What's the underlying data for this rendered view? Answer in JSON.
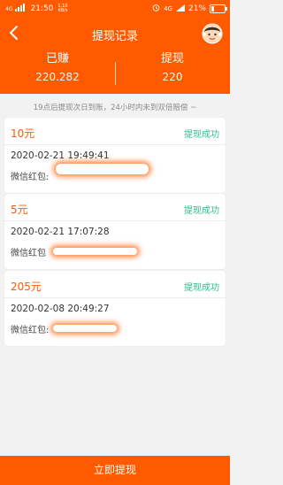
{
  "status_bar": {
    "network_left": "4G",
    "time": "21:50",
    "speed_value": "1.10",
    "speed_unit": "KB/s",
    "network_right": "4G",
    "battery": "21%",
    "battery_level": 0.21
  },
  "header": {
    "title": "提现记录"
  },
  "summary": {
    "earned_label": "已赚",
    "earned_value": "220.282",
    "withdrawn_label": "提现",
    "withdrawn_value": "220"
  },
  "notice": "19点后提现次日到账，24小时内未到双倍赔偿 ~",
  "records": [
    {
      "amount": "10元",
      "status": "提现成功",
      "datetime": "2020-02-21 19:49:41",
      "wallet": "微信红包:"
    },
    {
      "amount": "5元",
      "status": "提现成功",
      "datetime": "2020-02-21 17:07:28",
      "wallet": "微信红包"
    },
    {
      "amount": "205元",
      "status": "提现成功",
      "datetime": "2020-02-08 20:49:27",
      "wallet": "微信红包:"
    }
  ],
  "footer": {
    "button_label": "立即提现"
  },
  "colors": {
    "brand": "#ff5a00",
    "success": "#2bbf8f",
    "background": "#f2f2f2"
  }
}
